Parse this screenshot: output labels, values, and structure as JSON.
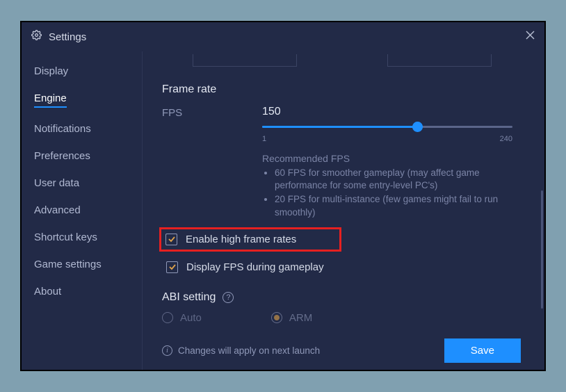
{
  "window": {
    "title": "Settings"
  },
  "sidebar": {
    "items": [
      {
        "label": "Display"
      },
      {
        "label": "Engine",
        "active": true
      },
      {
        "label": "Notifications"
      },
      {
        "label": "Preferences"
      },
      {
        "label": "User data"
      },
      {
        "label": "Advanced"
      },
      {
        "label": "Shortcut keys"
      },
      {
        "label": "Game settings"
      },
      {
        "label": "About"
      }
    ]
  },
  "frame_rate": {
    "section_title": "Frame rate",
    "fps_label": "FPS",
    "fps_value": "150",
    "slider_min": "1",
    "slider_max": "240",
    "recommended_title": "Recommended FPS",
    "recs": [
      "60 FPS for smoother gameplay (may affect game performance for some entry-level PC's)",
      "20 FPS for multi-instance (few games might fail to run smoothly)"
    ],
    "enable_high_label": "Enable high frame rates",
    "display_fps_label": "Display FPS during gameplay"
  },
  "abi": {
    "title": "ABI setting",
    "options": {
      "auto": "Auto",
      "arm": "ARM"
    }
  },
  "footer": {
    "message": "Changes will apply on next launch",
    "save_label": "Save"
  }
}
